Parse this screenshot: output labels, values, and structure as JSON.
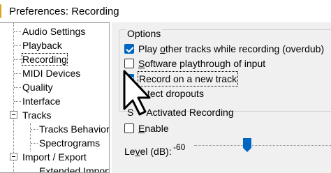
{
  "window": {
    "title": "Preferences: Recording"
  },
  "tree": {
    "items": [
      {
        "label": "Audio Settings"
      },
      {
        "label": "Playback"
      },
      {
        "label": "Recording"
      },
      {
        "label": "MIDI Devices"
      },
      {
        "label": "Quality"
      },
      {
        "label": "Interface"
      },
      {
        "label": "Tracks"
      },
      {
        "label": "Tracks Behaviors"
      },
      {
        "label": "Spectrograms"
      },
      {
        "label": "Import / Export"
      },
      {
        "label": "Extended Import"
      }
    ],
    "selected": "Recording"
  },
  "options": {
    "title": "Options",
    "play_other_tracks": {
      "pre": "Play ",
      "u": "o",
      "post": "ther tracks while recording (overdub)",
      "checked": true
    },
    "software_playthrough": {
      "pre": "",
      "u": "S",
      "post": "oftware playthrough of input",
      "checked": false
    },
    "record_new_track": {
      "pre": "Record on a new track",
      "u": "",
      "post": "",
      "checked": true
    },
    "detect_dropouts": {
      "pre": "Detect dropouts",
      "u": "",
      "post": "",
      "checked": true
    },
    "detect_dropouts_visible": "tect dropouts"
  },
  "sound_activated": {
    "title_visible": "Activated Recording",
    "title_prefix_visible": "S",
    "enable": {
      "pre": "",
      "u": "E",
      "post": "nable",
      "checked": false
    },
    "level_label_pre": "Le",
    "level_label_u": "v",
    "level_label_post": "el (dB):",
    "level_value": "-60"
  }
}
